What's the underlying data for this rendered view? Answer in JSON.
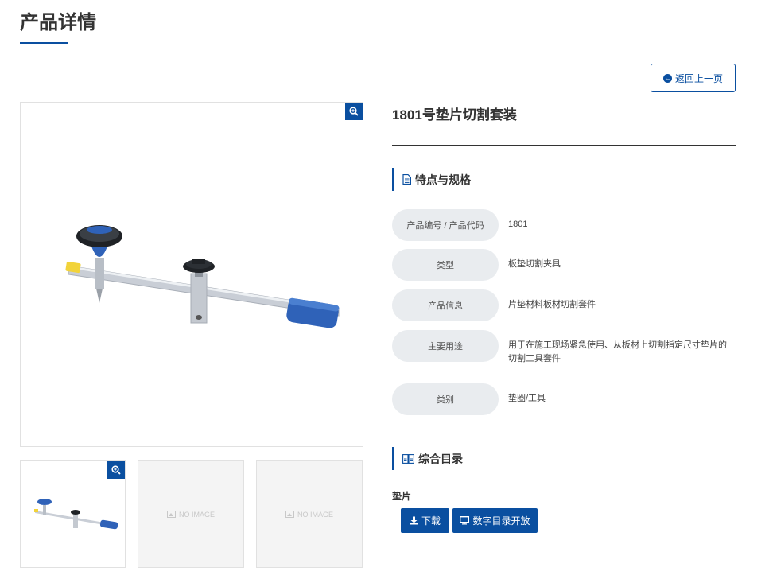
{
  "page": {
    "title": "产品详情"
  },
  "back_button": {
    "label": "返回上一页"
  },
  "product": {
    "name": "1801号垫片切割套装",
    "no_image_label": "NO IMAGE"
  },
  "specs": {
    "heading": "特点与规格",
    "rows": [
      {
        "label": "产品编号 / 产品代码",
        "value": "1801"
      },
      {
        "label": "类型",
        "value": "板垫切割夹具"
      },
      {
        "label": "产品信息",
        "value": "片垫材料板材切割套件"
      },
      {
        "label": "主要用途",
        "value_line1": "用于在施工现场紧急使用、从板材上切割指定尺寸垫片的",
        "value_line2": "切割工具套件"
      },
      {
        "label": "类别",
        "value": "垫圈/工具"
      }
    ]
  },
  "catalog": {
    "heading": "综合目录",
    "item_label": "垫片",
    "download_label": "下载",
    "digital_label": "数字目录开放"
  },
  "colors": {
    "accent": "#0a4fa0",
    "pill_bg": "#e9ecef",
    "thumb_bg": "#f4f4f4"
  }
}
